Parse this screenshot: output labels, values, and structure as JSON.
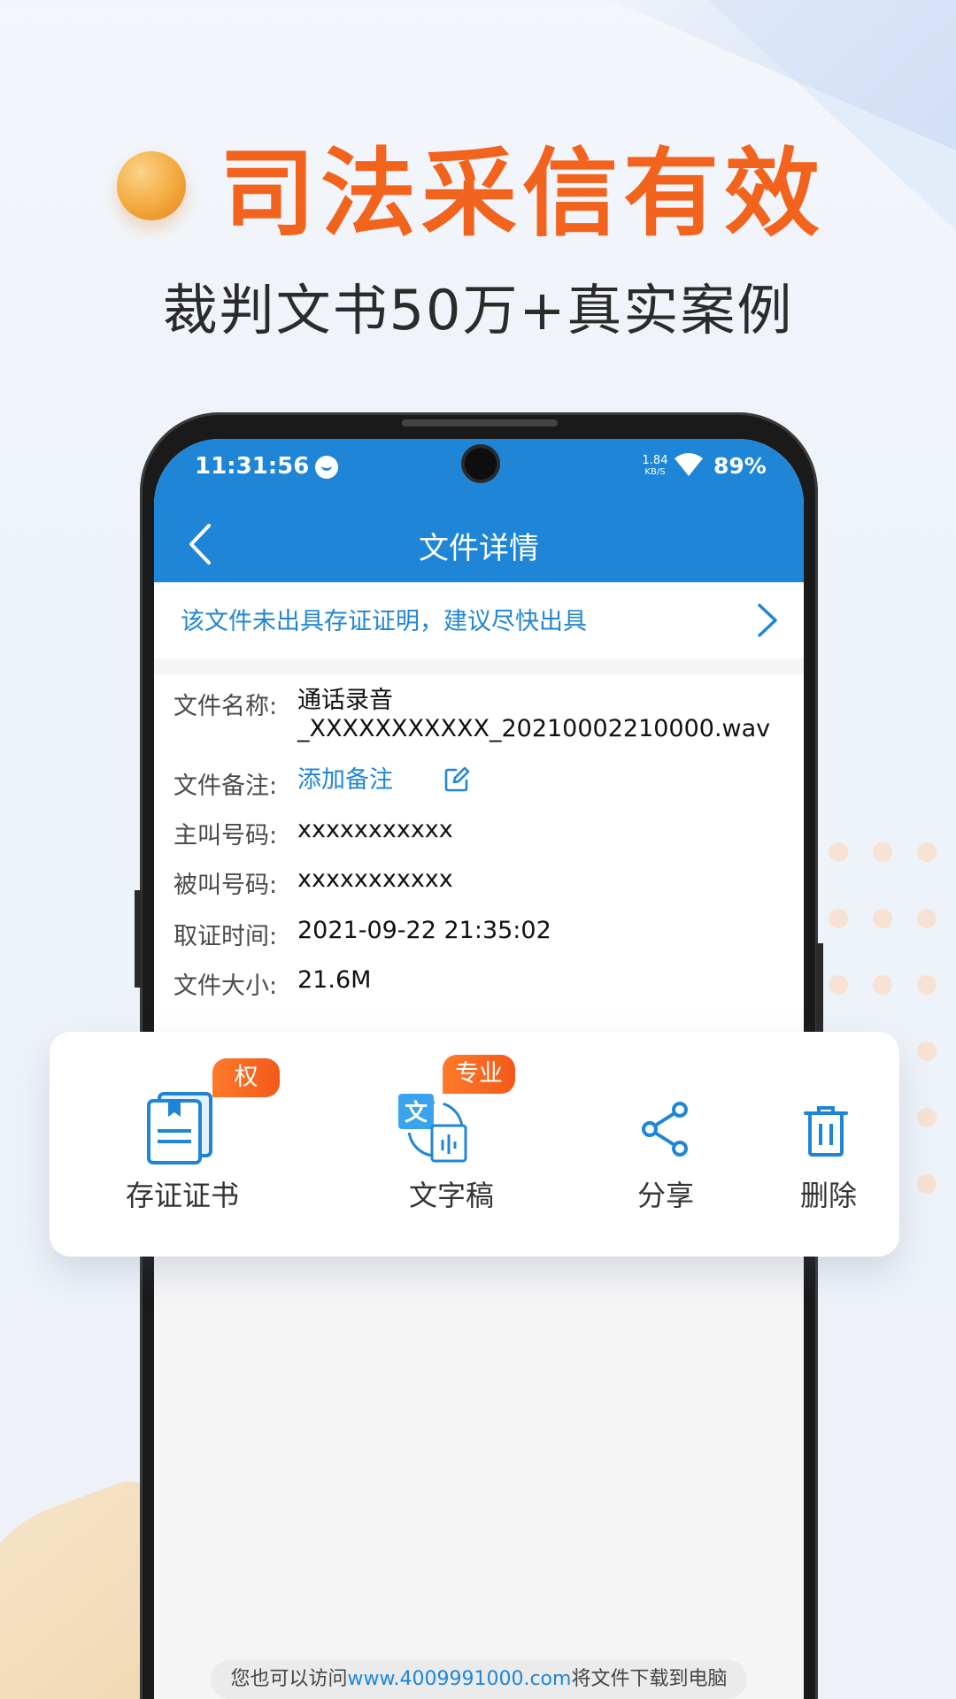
{
  "promo": {
    "title": "司法采信有效",
    "subtitle": "裁判文书50万+真实案例"
  },
  "status_bar": {
    "time": "11:31:56",
    "net_speed_value": "1.84",
    "net_speed_unit": "KB/S",
    "battery": "89%"
  },
  "app_bar": {
    "title": "文件详情",
    "back_icon": "chevron-left-icon"
  },
  "notice": {
    "text": "该文件未出具存证证明，建议尽快出具",
    "arrow_icon": "chevron-right-icon"
  },
  "details": {
    "file_name_label": "文件名称:",
    "file_name_line1": "通话录音",
    "file_name_line2": "_XXXXXXXXXXX_20210002210000.wav",
    "note_label": "文件备注:",
    "note_action": "添加备注",
    "caller_label": "主叫号码:",
    "caller_value": "xxxxxxxxxxx",
    "callee_label": "被叫号码:",
    "callee_value": "xxxxxxxxxxx",
    "time_label": "取证时间:",
    "time_value": "2021-09-22 21:35:02",
    "size_label": "文件大小:",
    "size_value": "21.6M"
  },
  "actions": [
    {
      "label": "存证证书",
      "badge": "权威",
      "icon": "certificate-icon"
    },
    {
      "label": "文字稿",
      "badge": "专业",
      "icon": "transcript-icon"
    },
    {
      "label": "分享",
      "icon": "share-icon"
    },
    {
      "label": "删除",
      "icon": "trash-icon"
    }
  ],
  "footer": {
    "prefix": "您也可以访问",
    "url": "www.4009991000.com",
    "suffix": "将文件下载到电脑"
  },
  "colors": {
    "primary_blue": "#1f86d7",
    "accent_orange": "#f2631e"
  }
}
